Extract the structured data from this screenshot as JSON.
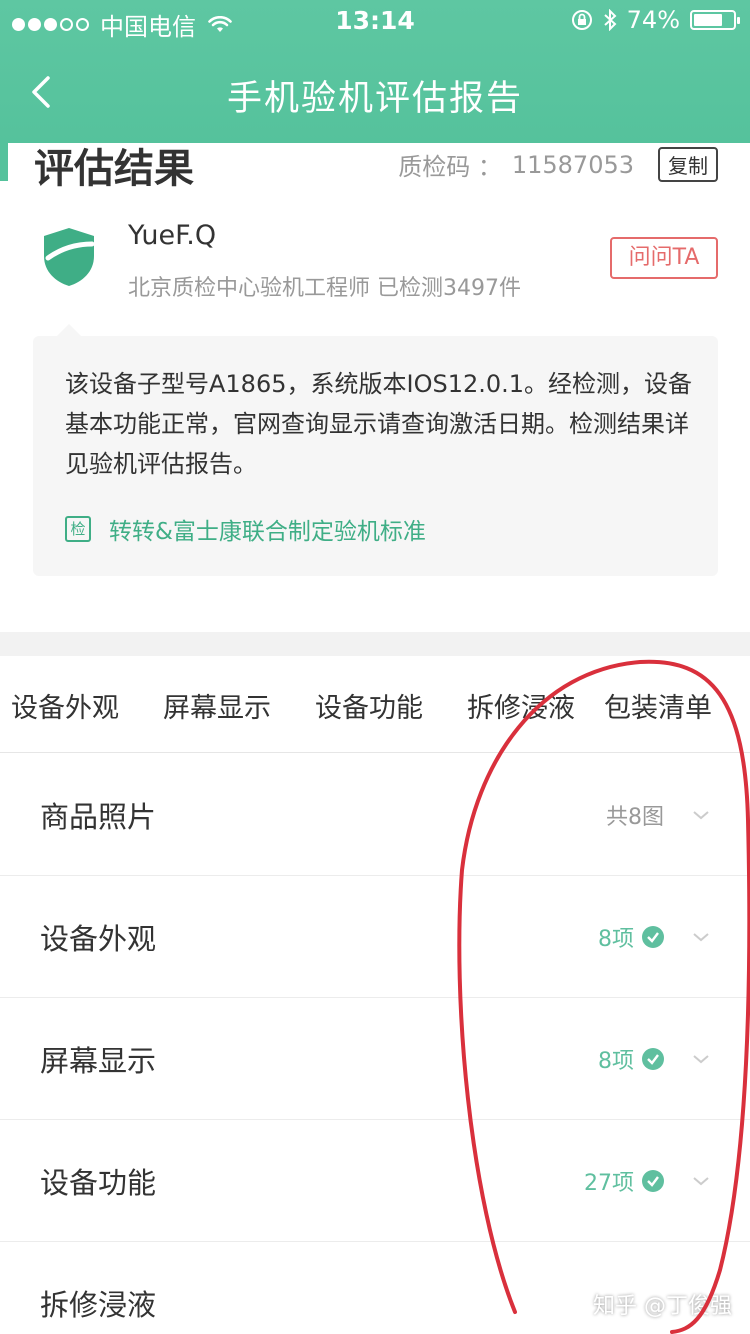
{
  "status_bar": {
    "carrier": "中国电信",
    "time": "13:14",
    "battery": "74%",
    "battery_level": 0.74
  },
  "nav": {
    "title": "手机验机评估报告"
  },
  "result": {
    "title": "评估结果",
    "qc_label": "质检码 ：",
    "qc_code": "11587053",
    "copy_label": "复制"
  },
  "inspector": {
    "name": "YueF.Q",
    "desc": "北京质检中心验机工程师 已检测3497件",
    "ask_label": "问问TA"
  },
  "summary": {
    "text": "该设备子型号A1865，系统版本IOS12.0.1。经检测，设备基本功能正常，官网查询显示请查询激活日期。检测结果详见验机评估报告。",
    "standard_icon": "检",
    "standard_text": "转转&富士康联合制定验机标准"
  },
  "tabs": [
    "设备外观",
    "屏幕显示",
    "设备功能",
    "拆修浸液",
    "包装清单"
  ],
  "rows": [
    {
      "label": "商品照片",
      "count": "共8图"
    },
    {
      "label": "设备外观",
      "count": "8项"
    },
    {
      "label": "屏幕显示",
      "count": "8项"
    },
    {
      "label": "设备功能",
      "count": "27项"
    },
    {
      "label": "拆修浸液",
      "count": "知乎 @丁俊强"
    }
  ],
  "colors": {
    "header": "#55c29c",
    "accent_green": "#3fae86",
    "ask_red": "#e56b6b",
    "annotation_red": "#d9303c"
  },
  "icons": [
    "back-arrow-icon",
    "wifi-icon",
    "lock-rotation-icon",
    "bluetooth-icon",
    "battery-icon",
    "shield-icon",
    "check-circle-icon",
    "chevron-down-icon"
  ]
}
